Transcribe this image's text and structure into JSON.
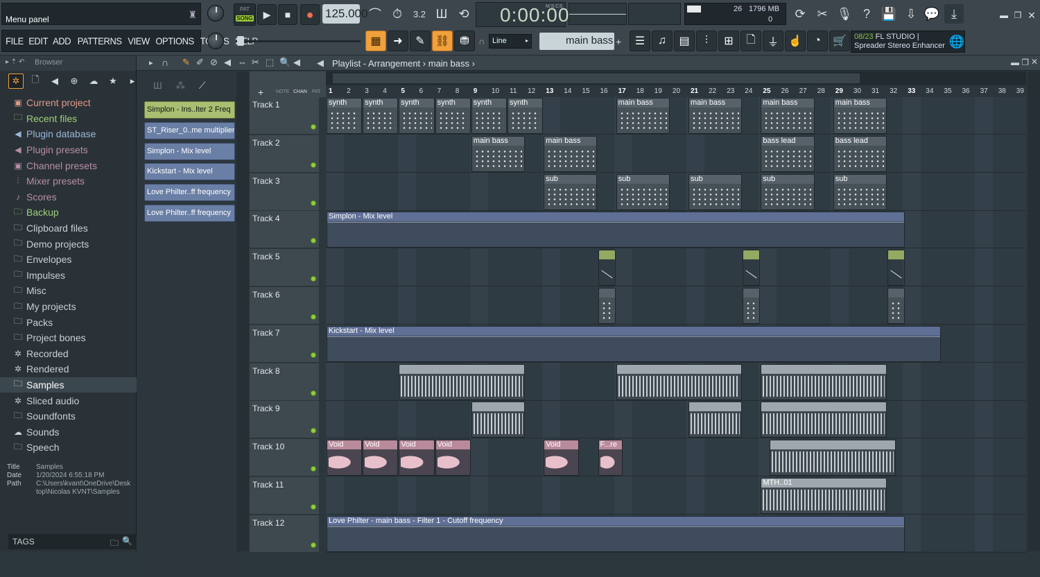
{
  "hint_panel": {
    "text": "Menu panel"
  },
  "menu": [
    "FILE",
    "EDIT",
    "ADD",
    "PATTERNS",
    "VIEW",
    "OPTIONS",
    "TOOLS",
    "HELP"
  ],
  "transport": {
    "pat": "PAT",
    "song": "SONG",
    "tempo": "125.000",
    "time": "0:00:00",
    "time_unit": "M:S:CS"
  },
  "cpu": {
    "voices": "26",
    "memory": "1796 MB",
    "zero": "0"
  },
  "toolbar": {
    "snap": "Line",
    "pattern": "main bass",
    "hint_date": "08/23",
    "hint_app": "FL STUDIO |",
    "hint_text": "Spreader Stereo Enhancer"
  },
  "browser": {
    "title": "Browser",
    "items": [
      "Current project",
      "Recent files",
      "Plugin database",
      "Plugin presets",
      "Channel presets",
      "Mixer presets",
      "Scores",
      "Backup",
      "Clipboard files",
      "Demo projects",
      "Envelopes",
      "Impulses",
      "Misc",
      "My projects",
      "Packs",
      "Project bones",
      "Recorded",
      "Rendered",
      "Samples",
      "Sliced audio",
      "Soundfonts",
      "Sounds",
      "Speech"
    ],
    "selected": "Samples",
    "info": {
      "title_label": "Title",
      "title": "Samples",
      "date_label": "Date",
      "date": "1/20/2024 6:55:18 PM",
      "path_label": "Path",
      "path": "C:\\Users\\kvant\\OneDrive\\Desktop\\Nicolas KVNT\\Samples"
    },
    "tags": "TAGS"
  },
  "playlist": {
    "title": "Playlist - Arrangement",
    "pattern": "main bass",
    "picker": [
      "Simplon - Ins..lter 2 Freq",
      "ST_Riser_0..me multiplier",
      "Simplon - Mix level",
      "Kickstart - Mix level",
      "Love Philter..ff frequency",
      "Love Philter..ff frequency"
    ],
    "ruler": [
      "1",
      "2",
      "3",
      "4",
      "5",
      "6",
      "7",
      "8",
      "9",
      "10",
      "11",
      "12",
      "13",
      "14",
      "15",
      "16",
      "17",
      "18",
      "19",
      "20",
      "21",
      "22",
      "23",
      "24",
      "25",
      "26",
      "27",
      "28",
      "29",
      "30",
      "31",
      "32",
      "33",
      "34",
      "35",
      "36",
      "37",
      "38",
      "39"
    ],
    "tracks": [
      "Track 1",
      "Track 2",
      "Track 3",
      "Track 4",
      "Track 5",
      "Track 6",
      "Track 7",
      "Track 8",
      "Track 9",
      "Track 10",
      "Track 11",
      "Track 12"
    ],
    "clip_labels": {
      "synth": "synth",
      "main_bass": "main bass",
      "bass_lead": "bass lead",
      "sub": "sub",
      "simplon": "Simplon - Mix level",
      "kickstart": "Kickstart - Mix level",
      "void": "Void",
      "fre": "F...re",
      "mth": "MTH..01",
      "love": "Love Philter - main bass - Filter 1 - Cutoff frequency"
    }
  },
  "colors": {
    "accent": "#f0a03c",
    "green": "#8fcf3b",
    "tempo_bg": "#c9d4d9"
  }
}
